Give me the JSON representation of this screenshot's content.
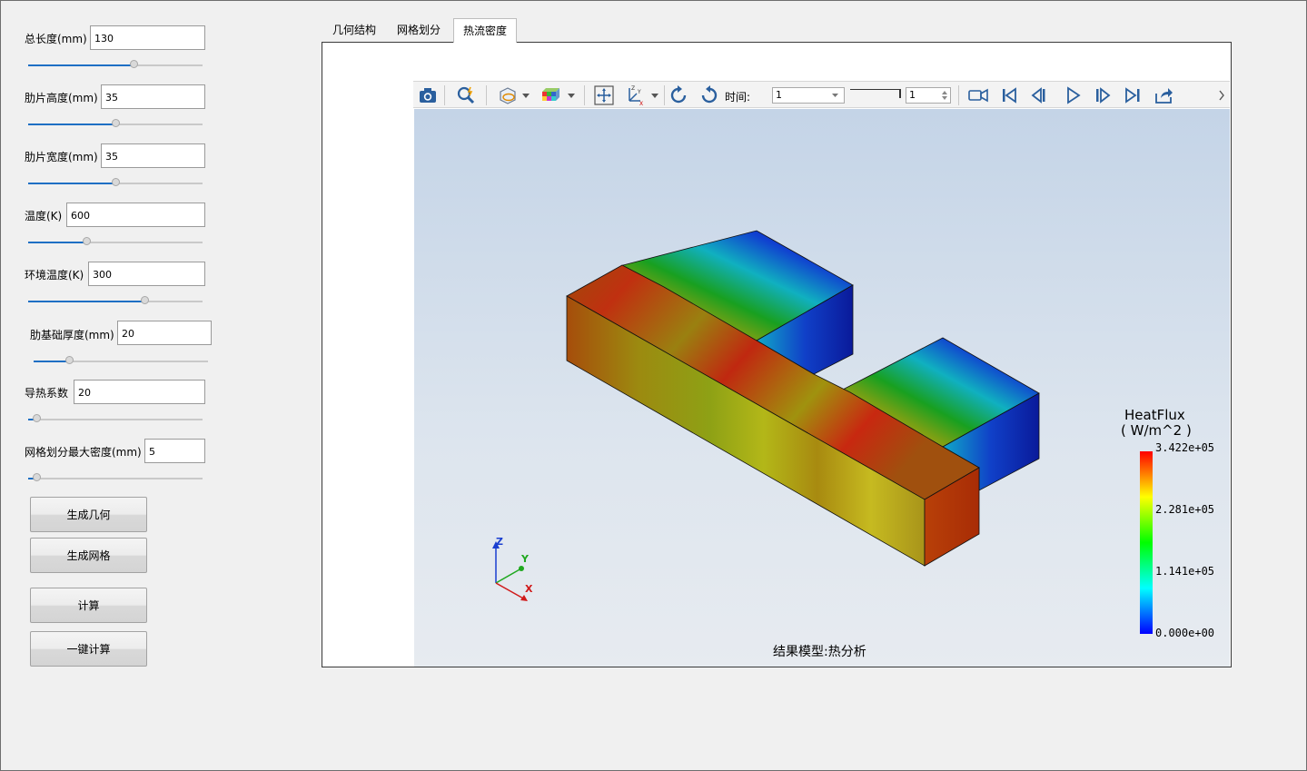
{
  "params": [
    {
      "label": "总长度(mm)",
      "value": "130",
      "slider": 0.61
    },
    {
      "label": "肋片高度(mm)",
      "value": "35",
      "slider": 0.5
    },
    {
      "label": "肋片宽度(mm)",
      "value": "35",
      "slider": 0.5
    },
    {
      "label": "温度(K)",
      "value": "600",
      "slider": 0.33
    },
    {
      "label": "环境温度(K)",
      "value": "300",
      "slider": 0.68
    },
    {
      "label": "肋基础厚度(mm)",
      "value": "20",
      "slider": 0.19
    },
    {
      "label": "导热系数",
      "value": "20",
      "slider": 0.03
    },
    {
      "label": "网格划分最大密度(mm)",
      "value": "5",
      "slider": 0.03
    }
  ],
  "buttons": {
    "gen_geometry": "生成几何",
    "gen_mesh": "生成网格",
    "compute": "计算",
    "one_click": "一键计算"
  },
  "tabs": [
    {
      "label": "几何结构",
      "active": false
    },
    {
      "label": "网格划分",
      "active": false
    },
    {
      "label": "热流密度",
      "active": true
    }
  ],
  "toolbar": {
    "time_label": "时间:",
    "time_combo_value": "1",
    "frame_value": "1",
    "icons": [
      "camera-icon",
      "probe-icon",
      "display-mode-icon",
      "color-cube-icon",
      "fit-view-icon",
      "axes-orient-icon",
      "rotate-ccw-icon",
      "rotate-cw-icon",
      "record-icon",
      "first-frame-icon",
      "prev-frame-icon",
      "play-icon",
      "next-frame-icon",
      "last-frame-icon",
      "export-icon"
    ]
  },
  "viewer": {
    "caption": "结果模型:热分析",
    "legend": {
      "title": "HeatFlux",
      "unit": "( W/m^2 )",
      "ticks": [
        "3.422e+05",
        "2.281e+05",
        "1.141e+05",
        "0.000e+00"
      ]
    },
    "axes": {
      "x": "X",
      "y": "Y",
      "z": "Z"
    }
  },
  "colors": {
    "accent": "#1e6fc4",
    "legend_stops": [
      "#ff0000",
      "#ffff00",
      "#00ff00",
      "#00ffff",
      "#0000ff"
    ]
  }
}
